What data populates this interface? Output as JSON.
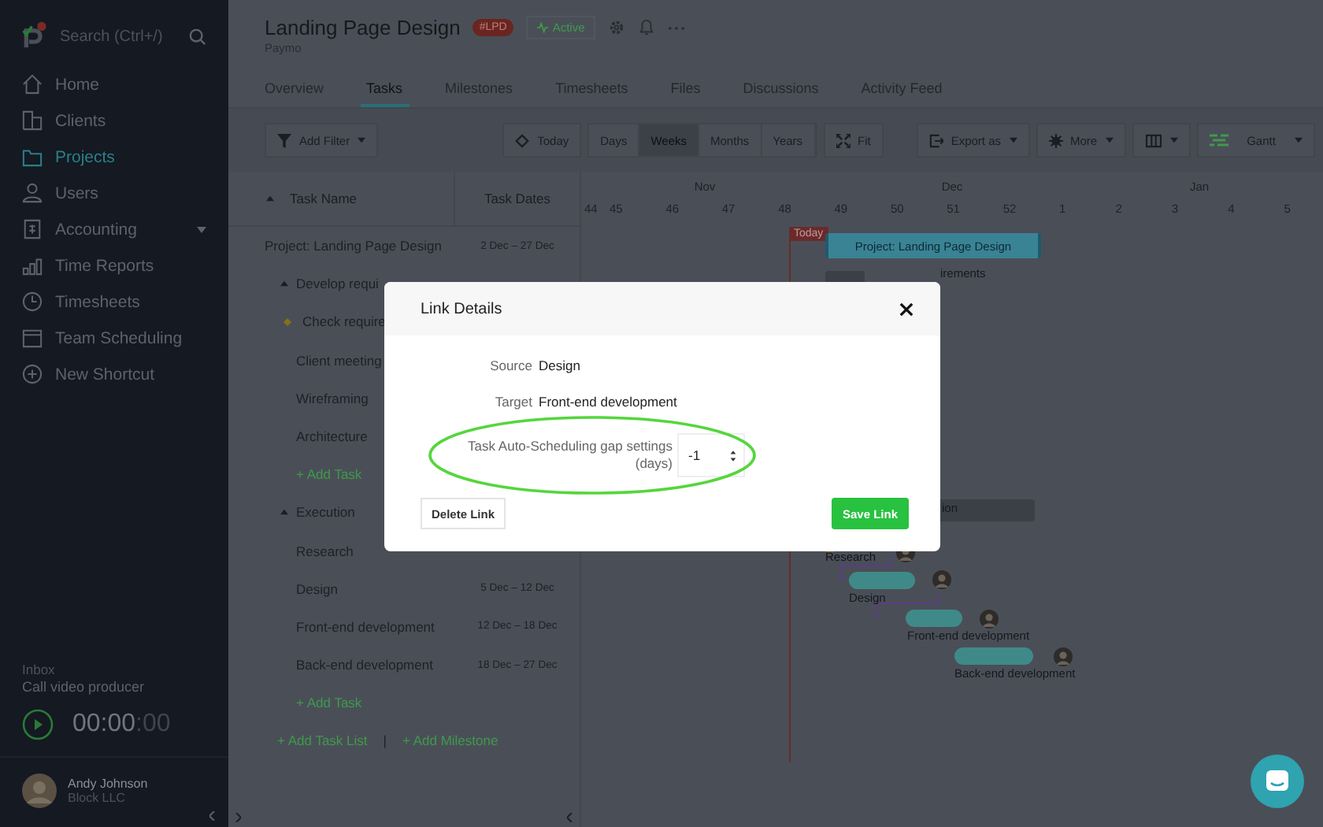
{
  "sidebar": {
    "search": {
      "placeholder": "Search (Ctrl+/)"
    },
    "items": [
      {
        "label": "Home",
        "selected": false,
        "expandable": false
      },
      {
        "label": "Clients",
        "selected": false,
        "expandable": false
      },
      {
        "label": "Projects",
        "selected": true,
        "expandable": false
      },
      {
        "label": "Users",
        "selected": false,
        "expandable": false
      },
      {
        "label": "Accounting",
        "selected": false,
        "expandable": true
      },
      {
        "label": "Time Reports",
        "selected": false,
        "expandable": false
      },
      {
        "label": "Timesheets",
        "selected": false,
        "expandable": false
      },
      {
        "label": "Team Scheduling",
        "selected": false,
        "expandable": false
      },
      {
        "label": "New Shortcut",
        "selected": false,
        "expandable": false
      }
    ],
    "inbox": {
      "label": "Inbox",
      "task": "Call video producer"
    },
    "timer": {
      "main": "00:00",
      "seconds": ":00"
    },
    "user": {
      "name": "Andy Johnson",
      "company": "Block LLC"
    }
  },
  "header": {
    "title": "Landing Page Design",
    "code": "#LPD",
    "status": "Active",
    "subtitle": "Paymo"
  },
  "tabs": [
    {
      "label": "Overview",
      "selected": false
    },
    {
      "label": "Tasks",
      "selected": true
    },
    {
      "label": "Milestones",
      "selected": false
    },
    {
      "label": "Timesheets",
      "selected": false
    },
    {
      "label": "Files",
      "selected": false
    },
    {
      "label": "Discussions",
      "selected": false
    },
    {
      "label": "Activity Feed",
      "selected": false
    }
  ],
  "toolbar": {
    "filter": "Add Filter",
    "today": "Today",
    "scales": [
      {
        "label": "Days",
        "selected": false
      },
      {
        "label": "Weeks",
        "selected": true
      },
      {
        "label": "Months",
        "selected": false
      },
      {
        "label": "Years",
        "selected": false
      }
    ],
    "fit": "Fit",
    "export": "Export as",
    "more": "More",
    "view": "Gantt"
  },
  "table": {
    "columns": [
      "Task Name",
      "Task Dates"
    ],
    "rows": [
      {
        "kind": "project",
        "name": "Project: Landing Page Design",
        "dates": "2 Dec – 27 Dec"
      },
      {
        "kind": "group",
        "name": "Develop requi"
      },
      {
        "kind": "milestone",
        "name": "Check require"
      },
      {
        "kind": "task",
        "name": "Client meeting"
      },
      {
        "kind": "task",
        "name": "Wireframing"
      },
      {
        "kind": "task",
        "name": "Architecture"
      },
      {
        "kind": "add",
        "name": "+ Add Task"
      },
      {
        "kind": "group",
        "name": "Execution"
      },
      {
        "kind": "task",
        "name": "Research"
      },
      {
        "kind": "task",
        "name": "Design",
        "dates": "5 Dec – 12 Dec"
      },
      {
        "kind": "task",
        "name": "Front-end development",
        "dates": "12 Dec – 18 Dec"
      },
      {
        "kind": "task",
        "name": "Back-end development",
        "dates": "18 Dec – 27 Dec"
      },
      {
        "kind": "add",
        "name": "+ Add Task"
      }
    ],
    "footer": {
      "add_list": "+ Add Task List",
      "separator": "|",
      "add_milestone": "+ Add Milestone"
    }
  },
  "gantt": {
    "months": [
      "Nov",
      "Dec",
      "Jan"
    ],
    "weeks": [
      "44",
      "45",
      "46",
      "47",
      "48",
      "49",
      "50",
      "51",
      "52",
      "1",
      "2",
      "3",
      "4",
      "5"
    ],
    "today_label": "Today",
    "items": [
      {
        "kind": "project",
        "label": "Project: Landing Page Design"
      },
      {
        "kind": "group",
        "label": "irements"
      },
      {
        "kind": "group",
        "label": "ion"
      },
      {
        "kind": "label",
        "label": "Research"
      },
      {
        "kind": "task",
        "label": "Design"
      },
      {
        "kind": "task",
        "label": "Front-end development"
      },
      {
        "kind": "task",
        "label": "Back-end development"
      }
    ]
  },
  "dialog": {
    "title": "Link Details",
    "fields": [
      {
        "label": "Source",
        "value": "Design"
      },
      {
        "label": "Target",
        "value": "Front-end development"
      }
    ],
    "gap": {
      "label": "Task Auto-Scheduling gap settings (days)",
      "value": "-1"
    },
    "delete": "Delete Link",
    "save": "Save Link"
  }
}
